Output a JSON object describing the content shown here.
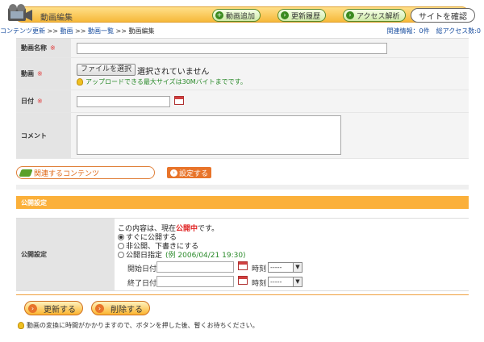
{
  "header": {
    "title": "動画編集",
    "buttons": {
      "add": "動画追加",
      "history": "更新履歴",
      "analytics": "アクセス解析",
      "view_site": "サイトを確認"
    }
  },
  "breadcrumb": {
    "items": [
      "コンテンツ更新",
      "動画",
      "動画一覧",
      "動画編集"
    ],
    "separator": ">>"
  },
  "stats": "関連情報：0件　総アクセス数:0",
  "form": {
    "name_label": "動画名称",
    "video_label": "動画",
    "date_label": "日付",
    "comment_label": "コメント",
    "required_mark": "※",
    "file_button": "ファイルを選択",
    "file_status": "選択されていません",
    "upload_hint": "アップロードできる最大サイズは30Mバイトまでです。",
    "name_value": "",
    "date_value": "",
    "comment_value": ""
  },
  "related": {
    "label": "関連するコンテンツ",
    "set_button": "設定する"
  },
  "publish": {
    "section_title": "公開設定",
    "label": "公開設定",
    "status_prefix": "この内容は、現在",
    "status_value": "公開中",
    "status_suffix": "です。",
    "options": [
      "すぐに公開する",
      "非公開、下書きにする",
      "公開日指定"
    ],
    "selected": 0,
    "example": "(例 2006/04/21 19:30)",
    "start_label": "開始日付",
    "end_label": "終了日付",
    "time_label": "時刻",
    "time_value": "-----"
  },
  "actions": {
    "update": "更新する",
    "delete": "削除する"
  },
  "note": "動画の変換に時間がかかりますので、ボタンを押した後、暫くお待ちください。",
  "colors": {
    "accent_orange": "#fbb03a",
    "header_yellow": "#f6b83a",
    "link_blue": "#1a4fa0",
    "required_red": "#e03a3a",
    "hint_green": "#2a8a2a"
  }
}
